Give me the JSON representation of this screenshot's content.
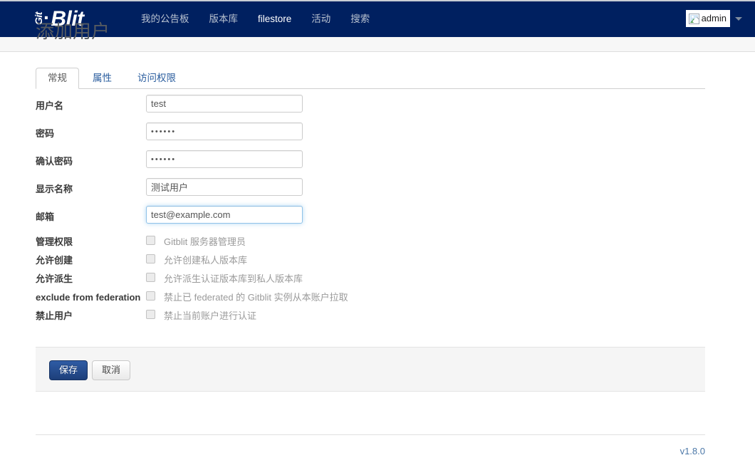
{
  "colors": {
    "navbar_bg": "#002060",
    "brand_text": "#ffffff",
    "nav_link": "#b9c2d0",
    "nav_link_active": "#ffffff",
    "primary_button": "#1d3f7a",
    "focus_border": "#8fc2e8",
    "link": "#2a5d9e",
    "version_link": "#4c78a8",
    "page_title": "#555a60"
  },
  "navbar": {
    "brand": {
      "git": "Git",
      "dot": "·",
      "blit": "Blit"
    },
    "links": [
      {
        "label": "我的公告板",
        "active": false
      },
      {
        "label": "版本库",
        "active": false
      },
      {
        "label": "filestore",
        "active": true
      },
      {
        "label": "活动",
        "active": false
      },
      {
        "label": "搜索",
        "active": false
      }
    ],
    "user": {
      "name": "admin",
      "avatar_icon": "broken-image-icon",
      "caret_icon": "chevron-down-icon"
    }
  },
  "page": {
    "title": "添加用户"
  },
  "tabs": [
    {
      "label": "常规",
      "active": true
    },
    {
      "label": "属性",
      "active": false
    },
    {
      "label": "访问权限",
      "active": false
    }
  ],
  "form": {
    "fields": [
      {
        "label": "用户名",
        "value": "test",
        "type": "text",
        "focused": false
      },
      {
        "label": "密码",
        "value": "••••••",
        "type": "password",
        "focused": false
      },
      {
        "label": "确认密码",
        "value": "••••••",
        "type": "password",
        "focused": false
      },
      {
        "label": "显示名称",
        "value": "测试用户",
        "type": "text",
        "focused": false
      },
      {
        "label": "邮箱",
        "value": "test@example.com",
        "type": "text",
        "focused": true
      }
    ],
    "checkboxes": [
      {
        "label": "管理权限",
        "help": "Gitblit 服务器管理员",
        "checked": false
      },
      {
        "label": "允许创建",
        "help": "允许创建私人版本库",
        "checked": false
      },
      {
        "label": "允许派生",
        "help": "允许派生认证版本库到私人版本库",
        "checked": false
      },
      {
        "label": "exclude from federation",
        "help": "禁止已 federated 的 Gitblit 实例从本账户拉取",
        "checked": false
      },
      {
        "label": "禁止用户",
        "help": "禁止当前账户进行认证",
        "checked": false
      }
    ]
  },
  "actions": {
    "save_label": "保存",
    "cancel_label": "取消"
  },
  "footer": {
    "version": "v1.8.0"
  }
}
